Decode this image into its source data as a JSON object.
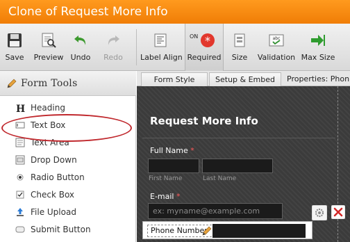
{
  "title": "Clone of Request More Info",
  "toolbar": {
    "save": "Save",
    "preview": "Preview",
    "undo": "Undo",
    "redo": "Redo",
    "label_align": "Label Align",
    "required_on": "ON",
    "required": "Required",
    "size": "Size",
    "validation": "Validation",
    "max_size": "Max Size"
  },
  "form_tools": {
    "title": "Form Tools",
    "items": [
      "Heading",
      "Text Box",
      "Text Area",
      "Drop Down",
      "Radio Button",
      "Check Box",
      "File Upload",
      "Submit Button"
    ]
  },
  "tabs": {
    "form_style": "Form Style",
    "setup_embed": "Setup & Embed",
    "properties": "Properties: Phon"
  },
  "form": {
    "title": "Request More Info",
    "full_name_label": "Full Name",
    "required_mark": "*",
    "first_name": "First Name",
    "last_name": "Last Name",
    "email_label": "E-mail",
    "email_placeholder": "ex: myname@example.com",
    "phone_label": "Phone Number"
  },
  "colors": {
    "title_orange": "#f58a0e",
    "highlight_oval": "#c0282d",
    "required_icon": "#e2372c",
    "form_bg": "#3b3b3b"
  },
  "icons": [
    "save-icon",
    "preview-icon",
    "undo-icon",
    "redo-icon",
    "label-align-icon",
    "required-icon",
    "size-icon",
    "validation-icon",
    "max-size-icon",
    "pencil-icon",
    "gear-icon",
    "close-icon"
  ]
}
